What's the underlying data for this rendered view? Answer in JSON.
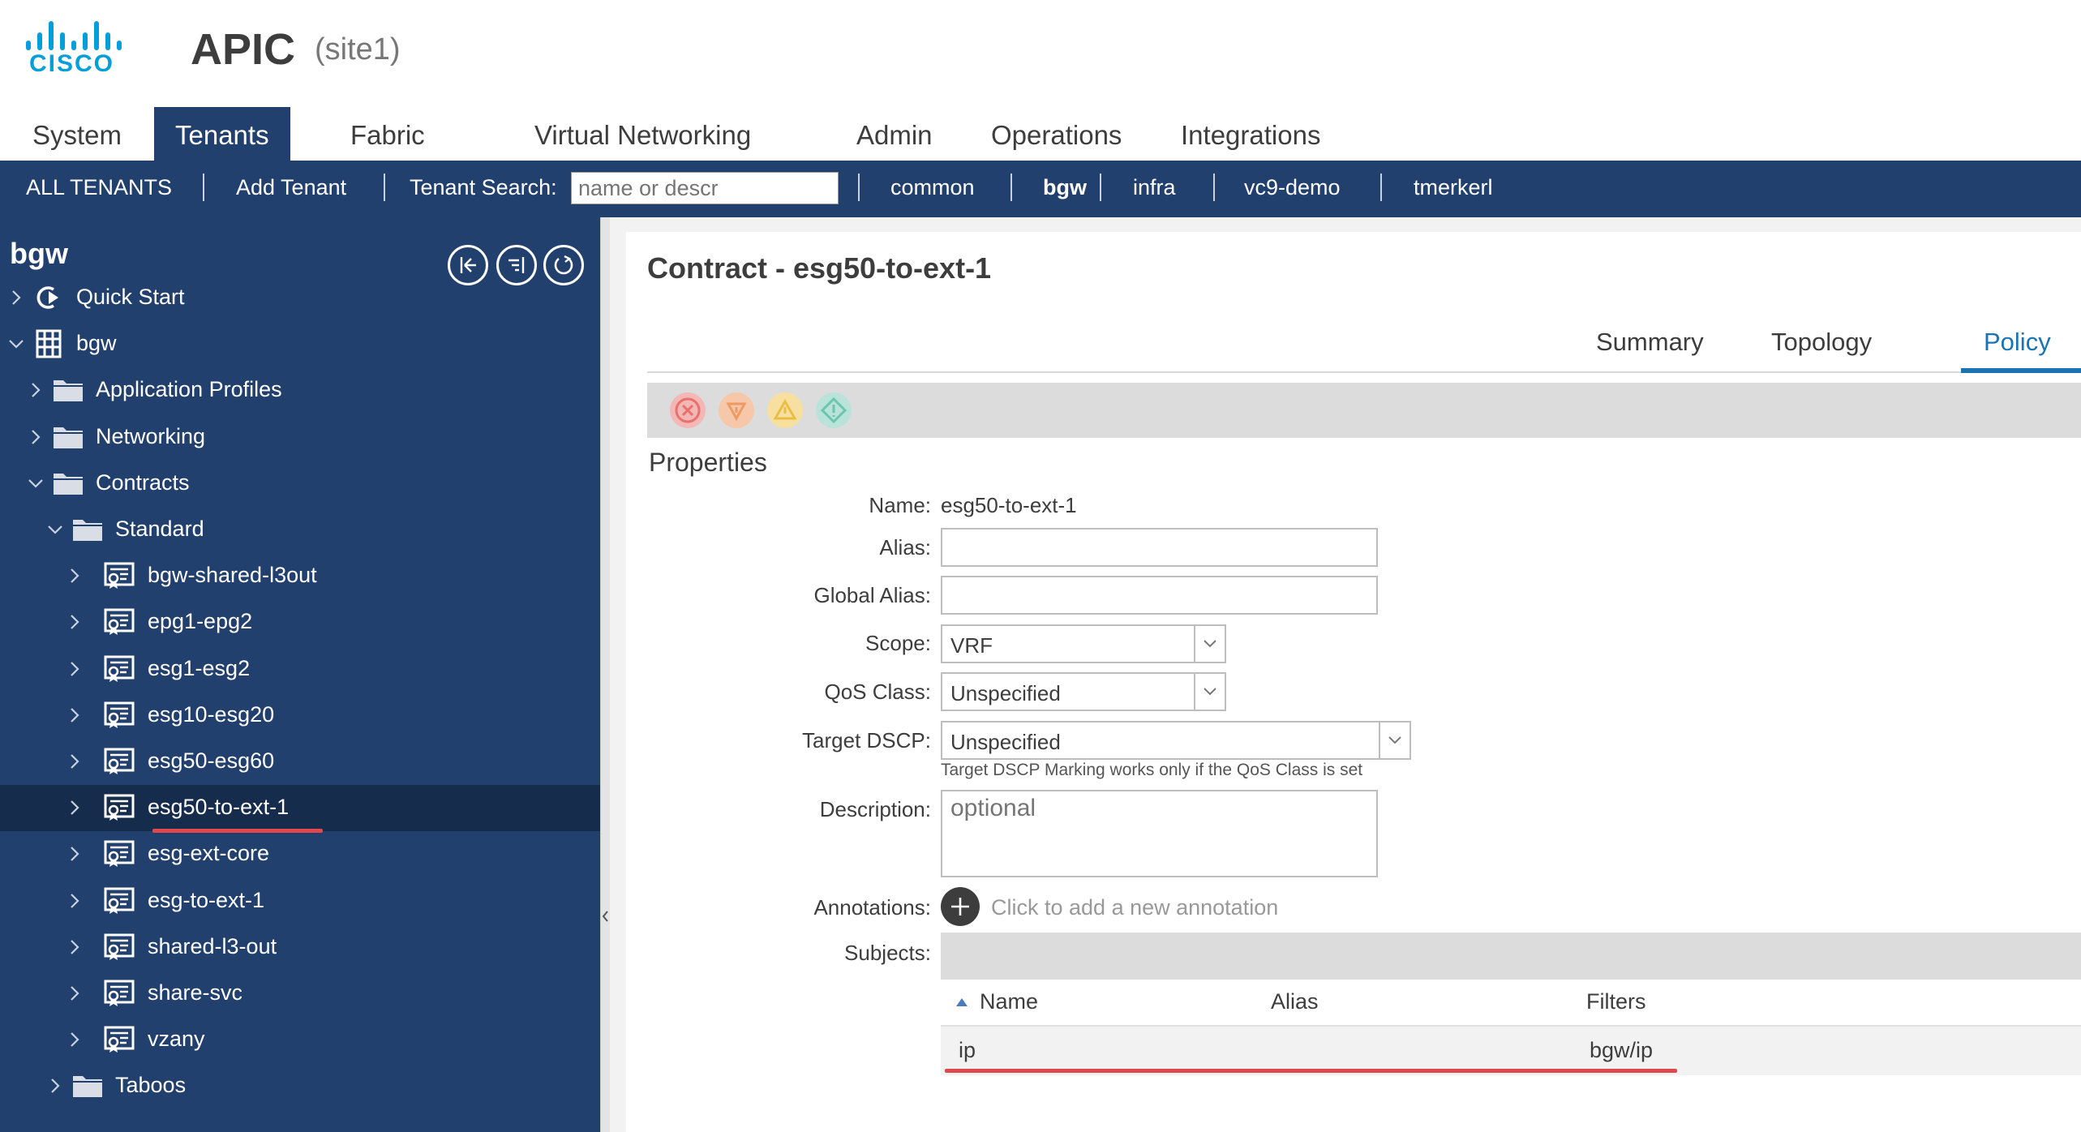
{
  "brand": {
    "logo_text": "CISCO",
    "app_name": "APIC",
    "site": "(site1)"
  },
  "main_nav": [
    {
      "label": "System",
      "active": false
    },
    {
      "label": "Tenants",
      "active": true
    },
    {
      "label": "Fabric",
      "active": false
    },
    {
      "label": "Virtual Networking",
      "active": false
    },
    {
      "label": "Admin",
      "active": false
    },
    {
      "label": "Operations",
      "active": false
    },
    {
      "label": "Integrations",
      "active": false
    }
  ],
  "sub_nav": {
    "all_tenants": "ALL TENANTS",
    "add_tenant": "Add Tenant",
    "search_label": "Tenant Search:",
    "search_placeholder": "name or descr",
    "tenants": [
      "common",
      "bgw",
      "infra",
      "vc9-demo",
      "tmerkerl"
    ],
    "active_tenant": "bgw"
  },
  "sidebar": {
    "title": "bgw",
    "toolbar_icons": [
      "collapse-tree-icon",
      "expand-tree-icon",
      "refresh-icon"
    ],
    "tree": [
      {
        "label": "Quick Start",
        "icon": "quick-start-icon",
        "expanded": false
      },
      {
        "label": "bgw",
        "icon": "tenant-building-icon",
        "expanded": true
      },
      {
        "label": "Application Profiles",
        "icon": "folder-icon",
        "expanded": false
      },
      {
        "label": "Networking",
        "icon": "folder-icon",
        "expanded": false
      },
      {
        "label": "Contracts",
        "icon": "folder-icon",
        "expanded": true
      },
      {
        "label": "Standard",
        "icon": "folder-icon",
        "expanded": true
      },
      {
        "label": "bgw-shared-l3out",
        "icon": "contract-icon",
        "expanded": false
      },
      {
        "label": "epg1-epg2",
        "icon": "contract-icon",
        "expanded": false
      },
      {
        "label": "esg1-esg2",
        "icon": "contract-icon",
        "expanded": false
      },
      {
        "label": "esg10-esg20",
        "icon": "contract-icon",
        "expanded": false
      },
      {
        "label": "esg50-esg60",
        "icon": "contract-icon",
        "expanded": false
      },
      {
        "label": "esg50-to-ext-1",
        "icon": "contract-icon",
        "expanded": false,
        "selected": true
      },
      {
        "label": "esg-ext-core",
        "icon": "contract-icon",
        "expanded": false
      },
      {
        "label": "esg-to-ext-1",
        "icon": "contract-icon",
        "expanded": false
      },
      {
        "label": "shared-l3-out",
        "icon": "contract-icon",
        "expanded": false
      },
      {
        "label": "share-svc",
        "icon": "contract-icon",
        "expanded": false
      },
      {
        "label": "vzany",
        "icon": "contract-icon",
        "expanded": false
      },
      {
        "label": "Taboos",
        "icon": "folder-icon",
        "expanded": false
      }
    ]
  },
  "content": {
    "title": "Contract - esg50-to-ext-1",
    "tabs": [
      {
        "label": "Summary",
        "active": false
      },
      {
        "label": "Topology",
        "active": false
      },
      {
        "label": "Policy",
        "active": true
      }
    ],
    "fault_icons": [
      "critical-fault-icon",
      "major-fault-icon",
      "minor-fault-icon",
      "warning-fault-icon"
    ],
    "section_title": "Properties",
    "fields": {
      "name": {
        "label": "Name:",
        "value": "esg50-to-ext-1"
      },
      "alias": {
        "label": "Alias:",
        "value": ""
      },
      "global_alias": {
        "label": "Global Alias:",
        "value": ""
      },
      "scope": {
        "label": "Scope:",
        "value": "VRF"
      },
      "qos_class": {
        "label": "QoS Class:",
        "value": "Unspecified"
      },
      "target_dscp": {
        "label": "Target DSCP:",
        "value": "Unspecified",
        "hint": "Target DSCP Marking works only if the QoS Class is set"
      },
      "description": {
        "label": "Description:",
        "placeholder": "optional"
      },
      "annotations": {
        "label": "Annotations:",
        "hint": "Click to add a new annotation"
      },
      "subjects": {
        "label": "Subjects:"
      }
    },
    "subjects_table": {
      "columns": [
        "Name",
        "Alias",
        "Filters"
      ],
      "rows": [
        {
          "name": "ip",
          "alias": "",
          "filters": "bgw/ip"
        }
      ]
    }
  },
  "colors": {
    "nav_dark": "#22406e",
    "selected_row": "#162c4d",
    "accent_blue": "#1a74b3",
    "cisco_blue": "#049fd9",
    "highlight_red": "#e2474b"
  }
}
